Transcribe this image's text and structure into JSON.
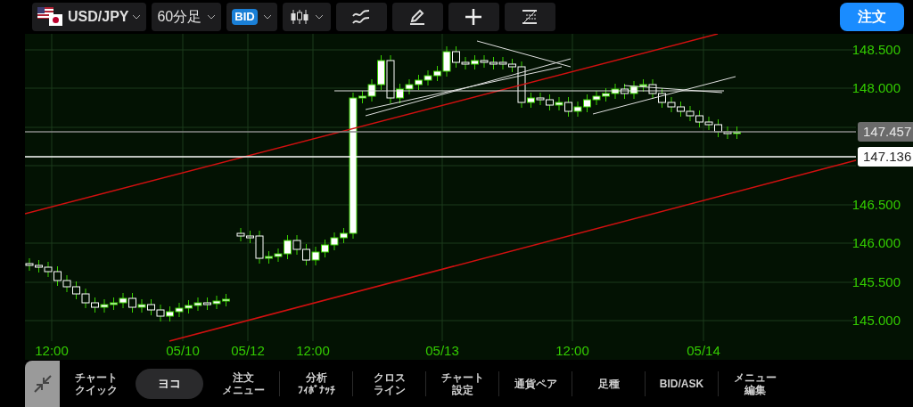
{
  "toolbar": {
    "symbol": "USD/JPY",
    "timeframe": "60分足",
    "price_type": "BID",
    "order_button": "注文"
  },
  "chart": {
    "price_labels": [
      "148.500",
      "148.000",
      "146.500",
      "146.000",
      "145.500",
      "145.000"
    ],
    "time_labels": [
      "12:00",
      "05/10",
      "05/12",
      "12:00",
      "05/13",
      "12:00",
      "05/14"
    ],
    "markers": [
      {
        "label": "147.457",
        "kind": "current"
      },
      {
        "label": "147.136",
        "kind": "line"
      }
    ]
  },
  "bottom_menu": [
    {
      "lines": [
        "チャート",
        "クイック"
      ],
      "selected": false
    },
    {
      "lines": [
        "ヨコ"
      ],
      "selected": true
    },
    {
      "lines": [
        "注文",
        "メニュー"
      ],
      "selected": false
    },
    {
      "lines": [
        "分析",
        "ﾌｨﾎﾞﾅｯﾁ"
      ],
      "selected": false
    },
    {
      "lines": [
        "クロス",
        "ライン"
      ],
      "selected": false
    },
    {
      "lines": [
        "チャート",
        "設定"
      ],
      "selected": false
    },
    {
      "lines": [
        "通貨ペア"
      ],
      "selected": false
    },
    {
      "lines": [
        "足種"
      ],
      "selected": false
    },
    {
      "lines": [
        "BID/ASK"
      ],
      "selected": false
    },
    {
      "lines": [
        "メニュー",
        "編集"
      ],
      "selected": false
    }
  ]
}
